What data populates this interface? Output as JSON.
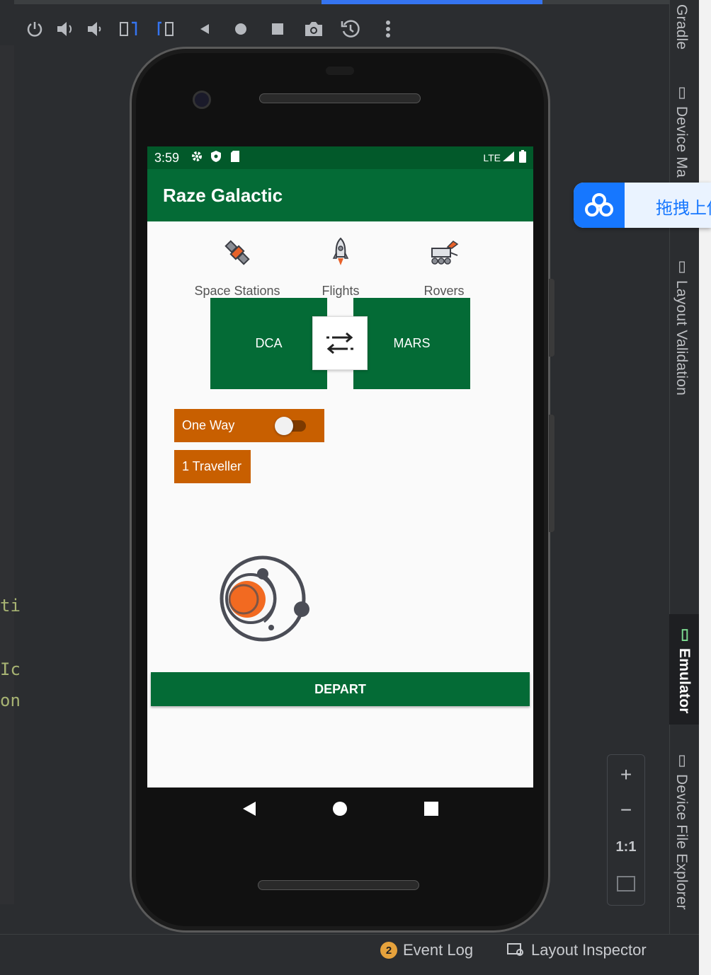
{
  "ide": {
    "code_fragments": [
      "ti",
      "Ic",
      "on"
    ],
    "right_rail": {
      "gradle": "Gradle",
      "device_manager": "Device Ma",
      "layout_validation": "Layout Validation",
      "emulator": "Emulator",
      "device_file_explorer": "Device File Explorer"
    },
    "status_bar": {
      "event_log_count": "2",
      "event_log": "Event Log",
      "layout_inspector": "Layout Inspector"
    },
    "zoom": {
      "plus": "+",
      "minus": "−",
      "one_to_one": "1:1"
    },
    "cloud_widget_text": "拖拽上传"
  },
  "device": {
    "status": {
      "time": "3:59",
      "network": "LTE"
    },
    "app_title": "Raze Galactic",
    "categories": [
      {
        "label": "Space Stations",
        "icon": "satellite-icon"
      },
      {
        "label": "Flights",
        "icon": "rocket-icon"
      },
      {
        "label": "Rovers",
        "icon": "rover-icon"
      }
    ],
    "origin": "DCA",
    "destination": "MARS",
    "one_way_label": "One Way",
    "one_way_enabled": false,
    "travellers_label": "1 Traveller",
    "depart_label": "DEPART",
    "colors": {
      "primary": "#046b36",
      "primary_dark": "#02592a",
      "accent": "#c85f00"
    }
  }
}
